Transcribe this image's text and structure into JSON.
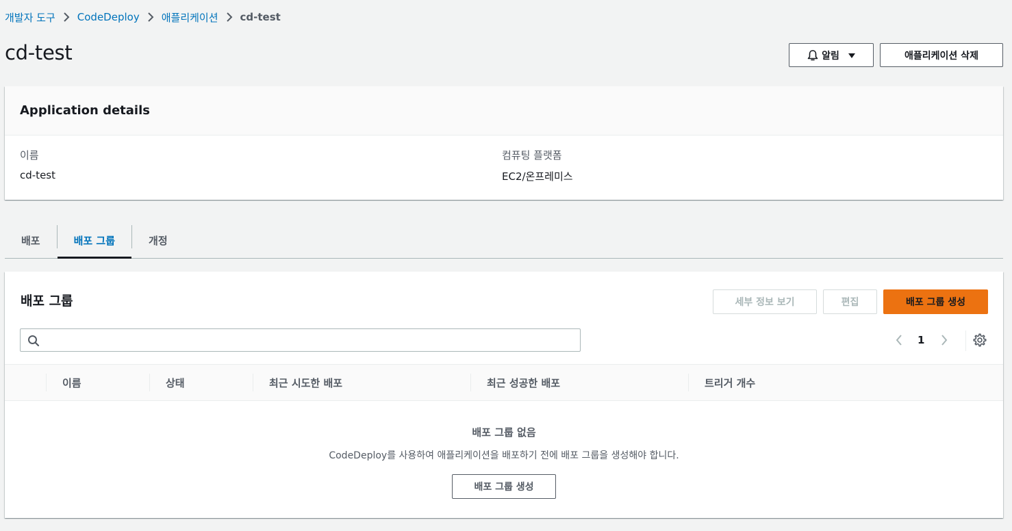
{
  "breadcrumb": {
    "items": [
      "개발자 도구",
      "CodeDeploy",
      "애플리케이션"
    ],
    "current": "cd-test"
  },
  "page": {
    "title": "cd-test",
    "notify_label": "알림",
    "delete_label": "애플리케이션 삭제"
  },
  "details": {
    "title": "Application details",
    "name_label": "이름",
    "name_value": "cd-test",
    "platform_label": "컴퓨팅 플랫폼",
    "platform_value": "EC2/온프레미스"
  },
  "tabs": [
    {
      "label": "배포",
      "active": false
    },
    {
      "label": "배포 그룹",
      "active": true
    },
    {
      "label": "개정",
      "active": false
    }
  ],
  "groups": {
    "title": "배포 그룹",
    "details_button": "세부 정보 보기",
    "edit_button": "편집",
    "create_button": "배포 그룹 생성",
    "search_placeholder": "",
    "page_number": "1",
    "columns": [
      "이름",
      "상태",
      "최근 시도한 배포",
      "최근 성공한 배포",
      "트리거 개수"
    ],
    "empty_title": "배포 그룹 없음",
    "empty_description": "CodeDeploy를 사용하여 애플리케이션을 배포하기 전에 배포 그룹을 생성해야 합니다.",
    "empty_create_button": "배포 그룹 생성"
  },
  "colors": {
    "link": "#0073bb",
    "primary_button": "#ec7211",
    "background": "#f2f3f3"
  }
}
